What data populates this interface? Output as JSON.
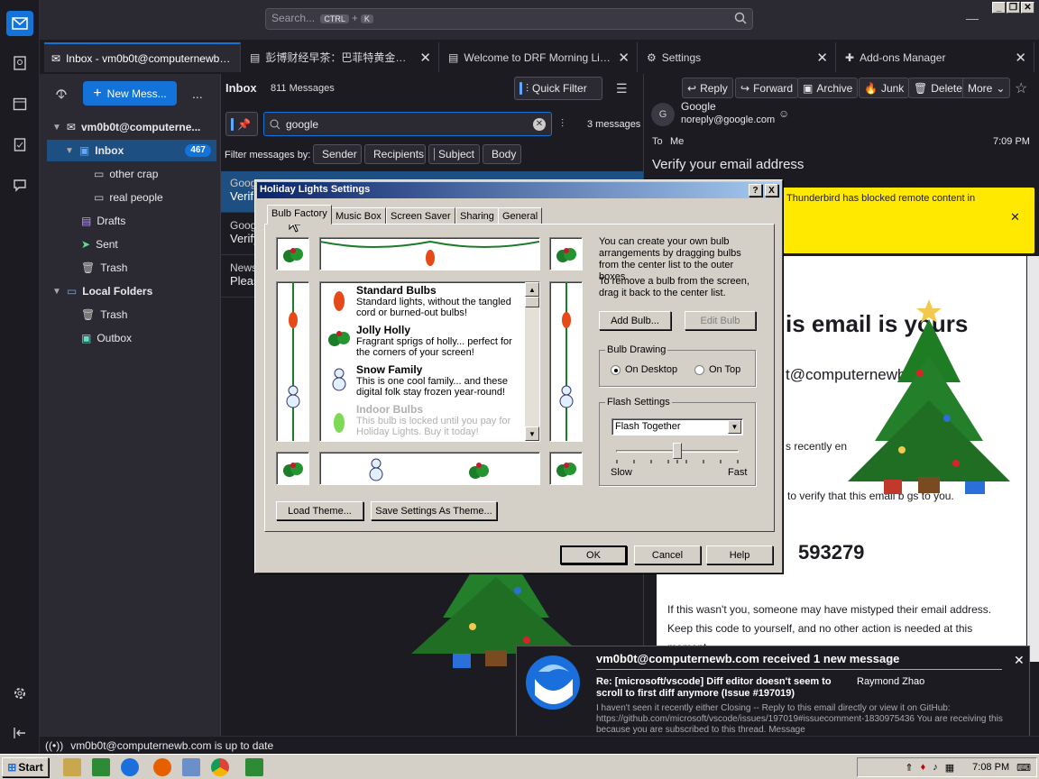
{
  "titlebar": {
    "search_placeholder": "Search...",
    "search_kbd1": "CTRL",
    "search_plus": "+",
    "search_kbd2": "K"
  },
  "tabs": [
    {
      "label": "Inbox - vm0b0t@computernewb.com"
    },
    {
      "label": "彭博财经早茶：巴菲特黄金搭档"
    },
    {
      "label": "Welcome to DRF Morning Line Newsletter"
    },
    {
      "label": "Settings"
    },
    {
      "label": "Add-ons Manager"
    }
  ],
  "folders": {
    "new_message": "New Mess...",
    "more": "...",
    "account": "vm0b0t@computerne...",
    "inbox": "Inbox",
    "inbox_count": "467",
    "sub1": "other crap",
    "sub2": "real people",
    "drafts": "Drafts",
    "sent": "Sent",
    "trash": "Trash",
    "local": "Local Folders",
    "local_trash": "Trash",
    "outbox": "Outbox"
  },
  "threads": {
    "title": "Inbox",
    "count": "811 Messages",
    "quick_filter": "Quick Filter",
    "search_value": "google",
    "results": "3 messages",
    "filter_by": "Filter messages by:",
    "filter_opts": [
      "Sender",
      "Recipients",
      "Subject",
      "Body"
    ],
    "rows": [
      {
        "from": "Goog",
        "subject": "Verif"
      },
      {
        "from": "Googl",
        "subject": "Verify"
      },
      {
        "from": "News",
        "subject": "Pleas"
      }
    ]
  },
  "message": {
    "actions": [
      "Reply",
      "Forward",
      "Archive",
      "Junk",
      "Delete",
      "More"
    ],
    "avatar": "G",
    "from_name": "Google",
    "from_email": "noreply@google.com",
    "to_label": "To",
    "to_value": "Me",
    "time": "7:09 PM",
    "subject": "Verify your email address",
    "notice": "Thunderbird has blocked remote content in",
    "body_heading": "is email is yours",
    "body_email": "t@computernewb",
    "body_line1": "s recently en",
    "body_line2": "to verify that this email b  gs to you.",
    "code": "593279",
    "body_p": "If this wasn't you, someone may have mistyped their email address. Keep this code to yourself, and no other action is needed at this moment."
  },
  "dialog": {
    "title": "Holiday Lights Settings",
    "help_btn": "?",
    "close_btn": "X",
    "tabs": [
      "Bulb Factory",
      "Music Box",
      "Screen Saver",
      "Sharing",
      "General"
    ],
    "bulbs": [
      {
        "name": "Standard Bulbs",
        "desc": "Standard lights, without the tangled cord or burned-out bulbs!"
      },
      {
        "name": "Jolly Holly",
        "desc": "Fragrant sprigs of holly... perfect for the corners of your screen!"
      },
      {
        "name": "Snow Family",
        "desc": "This is one cool family... and these digital folk stay frozen year-round!"
      },
      {
        "name": "Indoor Bulbs",
        "desc": "This bulb is locked until you pay for Holiday Lights. Buy it today!"
      }
    ],
    "help_text1": "You can create your own bulb arrangements by dragging bulbs from the center list to the outer boxes.",
    "help_text2": "To remove a bulb from the screen, drag it back to the center list.",
    "add_bulb": "Add Bulb...",
    "edit_bulb": "Edit Bulb",
    "bulb_drawing": "Bulb Drawing",
    "on_desktop": "On Desktop",
    "on_top": "On Top",
    "flash_settings": "Flash Settings",
    "flash_mode": "Flash Together",
    "slow": "Slow",
    "fast": "Fast",
    "flash_speed": 0.5,
    "load_theme": "Load Theme...",
    "save_theme": "Save Settings As Theme...",
    "ok": "OK",
    "cancel": "Cancel",
    "help": "Help"
  },
  "notification": {
    "title": "vm0b0t@computernewb.com received 1 new message",
    "subject": "Re: [microsoft/vscode] Diff editor doesn't seem to scroll to first diff anymore (Issue #197019)",
    "sender": "Raymond Zhao",
    "preview": "I haven't seen it recently either Closing -- Reply to this email directly or view it on GitHub: https://github.com/microsoft/vscode/issues/197019#issuecomment-1830975436 You are receiving this because you are subscribed to this thread. Message"
  },
  "status": {
    "text": "vm0b0t@computernewb.com is up to date"
  },
  "taskbar": {
    "start": "Start",
    "clock": "7:08 PM"
  },
  "colors": {
    "accent": "#1373d9",
    "notice": "#ffe900",
    "dialog_title": "#0a246a"
  }
}
